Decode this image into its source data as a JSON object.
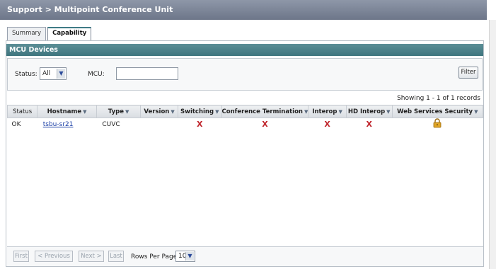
{
  "header": {
    "title": "Support > Multipoint Conference Unit"
  },
  "tabs": [
    {
      "label": "Summary"
    },
    {
      "label": "Capability"
    }
  ],
  "section": {
    "title": "MCU Devices"
  },
  "filters": {
    "status_label": "Status:",
    "status_value": "All",
    "mcu_label": "MCU:",
    "mcu_value": "",
    "filter_button": "Filter"
  },
  "table": {
    "record_count": "Showing 1 - 1 of 1 records",
    "columns": [
      "Status",
      "Hostname",
      "Type",
      "Version",
      "Switching",
      "Conference Termination",
      "Interop",
      "HD Interop",
      "Web Services Security"
    ],
    "rows": [
      {
        "status": "OK",
        "hostname": "tsbu-sr21",
        "type": "CUVC",
        "version": "",
        "switching": "X",
        "conference_termination": "X",
        "interop": "X",
        "hd_interop": "X",
        "web_services_security": "lock-icon"
      }
    ]
  },
  "pager": {
    "first": "First",
    "previous": "< Previous",
    "next": "Next >",
    "last": "Last",
    "rows_per_page_label": "Rows Per Page:",
    "rows_per_page_value": "10"
  },
  "colors": {
    "accent": "#3e757e",
    "title_bar": "#6d7689",
    "fail_mark": "#c0262d",
    "link": "#1b3fa6"
  }
}
